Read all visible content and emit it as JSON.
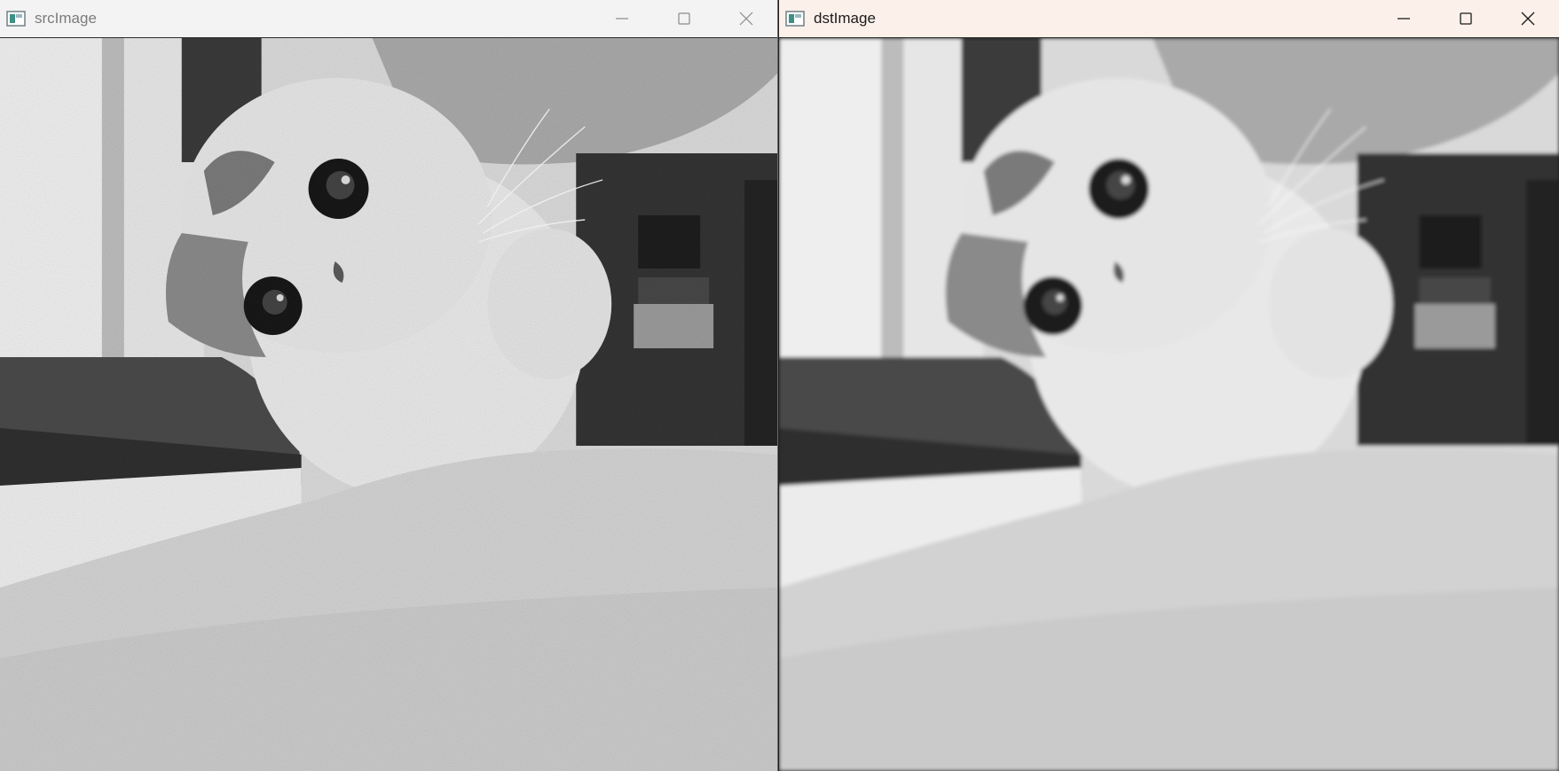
{
  "windows": [
    {
      "id": "src",
      "title": "srcImage",
      "active": false,
      "image": {
        "subject": "grayscale photo of a white kitten with noise",
        "style": "noisy"
      }
    },
    {
      "id": "dst",
      "title": "dstImage",
      "active": true,
      "image": {
        "subject": "grayscale photo of a white kitten, smoothed",
        "style": "blurred"
      }
    }
  ],
  "controls": [
    "minimize-icon",
    "maximize-icon",
    "close-icon"
  ]
}
